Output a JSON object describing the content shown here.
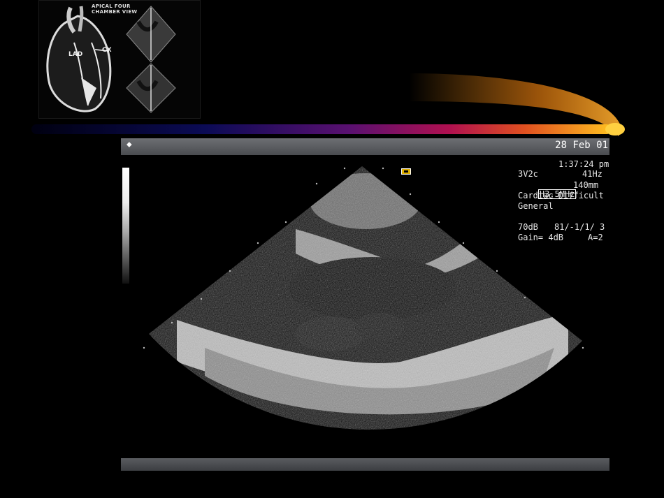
{
  "inset": {
    "title": "APICAL FOUR\nCHAMBER VIEW",
    "label_lad": "LAD",
    "label_cx": "CX"
  },
  "scan": {
    "date": "28 Feb 01",
    "time": "1:37:24 pm",
    "probe": "3V2c",
    "frame_rate": "41Hz",
    "frequency": "H3.5MHz",
    "depth": "140mm",
    "preset": "Cardiac Difficult",
    "mode": "General",
    "dynamic_range": "70dB",
    "settings": "81/-1/1/ 3",
    "gain": "Gain= 4dB",
    "averaging": "A=2"
  },
  "colors": {
    "background": "#000000",
    "accent_orange": "#ff9a1a",
    "swoosh_start": "#0a0a3a",
    "swoosh_mid": "#8a1050"
  }
}
